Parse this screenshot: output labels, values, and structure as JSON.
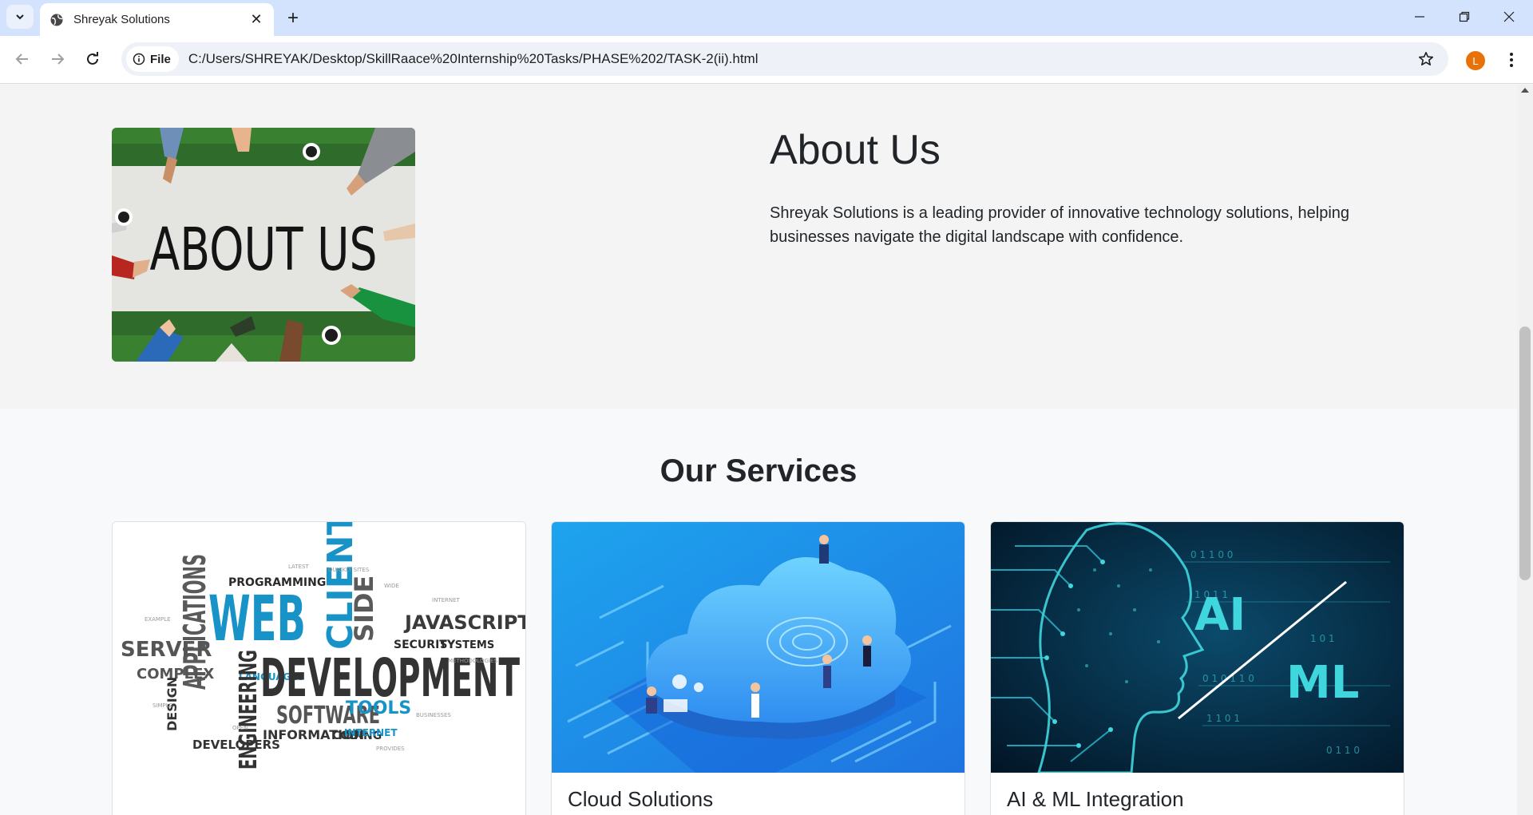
{
  "browser": {
    "tab_title": "Shreyak Solutions",
    "chip_label": "File",
    "url": "C:/Users/SHREYAK/Desktop/SkillRaace%20Internship%20Tasks/PHASE%202/TASK-2(ii).html",
    "profile_initial": "L"
  },
  "about": {
    "image_text": "ABOUT US",
    "title": "About Us",
    "text": "Shreyak Solutions is a leading provider of innovative technology solutions, helping businesses navigate the digital landscape with confidence."
  },
  "services": {
    "title": "Our Services",
    "cards": [
      {
        "title": "",
        "image_words": {
          "web": "WEB",
          "development": "DEVELOPMENT",
          "applications": "APPLICATIONS",
          "client": "CLIENT",
          "server": "SERVER",
          "javascript": "JAVASCRIPT",
          "software": "SOFTWARE",
          "engineering": "ENGINEERING",
          "side": "SIDE",
          "tools": "TOOLS",
          "programming": "PROGRAMMING",
          "complex": "COMPLEX",
          "design": "DESIGN",
          "information": "INFORMATION",
          "coding": "CODING",
          "developers": "DEVELOPERS",
          "security": "SECURITY",
          "systems": "SYSTEMS",
          "internet": "INTERNET",
          "languages": "LANGUAGES"
        }
      },
      {
        "title": "Cloud Solutions"
      },
      {
        "title": "AI & ML Integration",
        "image_words": {
          "ai": "AI",
          "ml": "ML"
        }
      }
    ]
  },
  "colors": {
    "tabbar": "#d3e3fd",
    "avatar": "#e8710a",
    "ai_bg": "#031a2c",
    "ai_accent": "#3fd6dd",
    "cloud_bg": "#1ea4ee",
    "web_blue": "#1793c7"
  }
}
